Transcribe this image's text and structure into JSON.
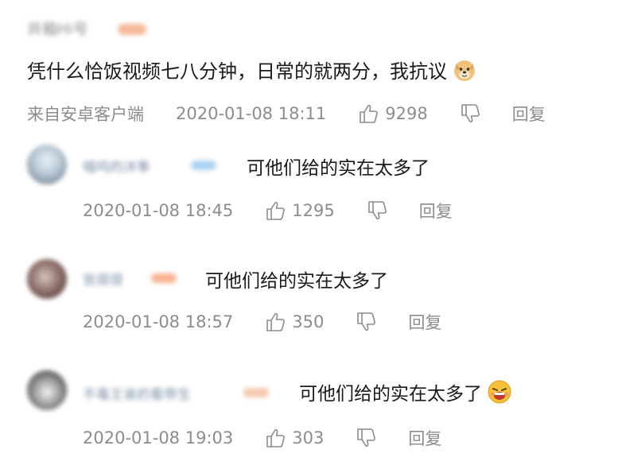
{
  "main_comment": {
    "username": "井箱Hi号",
    "text": "凭什么恰饭视频七八分钟，日常的就两分，我抗议",
    "emoji": "doge-icon",
    "source": "来自安卓客户端",
    "timestamp": "2020-01-08 18:11",
    "likes": "9298",
    "reply_label": "回复"
  },
  "replies": [
    {
      "username": "喵呜的沐筝",
      "text": "可他们给的实在太多了",
      "timestamp": "2020-01-08 18:45",
      "likes": "1295",
      "reply_label": "回复",
      "badge_color": "#a9d4f5"
    },
    {
      "username": "张很很",
      "text": "可他们给的实在太多了",
      "timestamp": "2020-01-08 18:57",
      "likes": "350",
      "reply_label": "回复",
      "badge_color": "#f7b38f"
    },
    {
      "username": "不毒王诶的看带生",
      "text": "可他们给的实在太多了",
      "timestamp": "2020-01-08 19:03",
      "likes": "303",
      "reply_label": "回复",
      "emoji": "grin-laugh-icon",
      "badge_color": "#f7c7ae"
    }
  ]
}
